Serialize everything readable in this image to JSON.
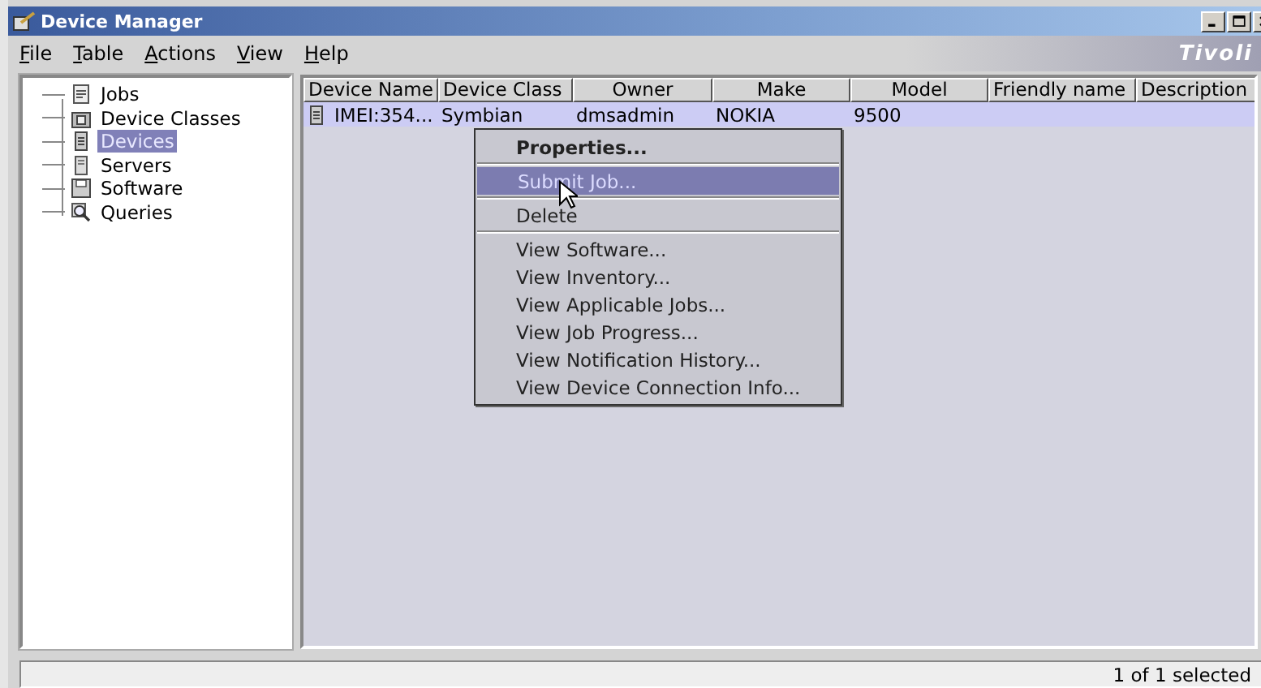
{
  "window": {
    "title": "Device Manager"
  },
  "menubar": [
    {
      "label": "File"
    },
    {
      "label": "Table"
    },
    {
      "label": "Actions"
    },
    {
      "label": "View"
    },
    {
      "label": "Help"
    }
  ],
  "brand": "Tivoli",
  "tree": [
    {
      "label": "Jobs",
      "selected": false
    },
    {
      "label": "Device Classes",
      "selected": false
    },
    {
      "label": "Devices",
      "selected": true
    },
    {
      "label": "Servers",
      "selected": false
    },
    {
      "label": "Software",
      "selected": false
    },
    {
      "label": "Queries",
      "selected": false
    }
  ],
  "table": {
    "columns": [
      "Device Name",
      "Device Class",
      "Owner",
      "Make",
      "Model",
      "Friendly name",
      "Description"
    ],
    "rows": [
      {
        "selected": true,
        "cells": [
          "IMEI:354...",
          "Symbian",
          "dmsadmin",
          "NOKIA",
          "9500",
          "",
          ""
        ]
      }
    ]
  },
  "context_menu": [
    {
      "kind": "item",
      "label": "Properties...",
      "default": true,
      "selected": false
    },
    {
      "kind": "separator"
    },
    {
      "kind": "item",
      "label": "Submit Job...",
      "default": false,
      "selected": true
    },
    {
      "kind": "separator"
    },
    {
      "kind": "item",
      "label": "Delete",
      "default": false,
      "selected": false
    },
    {
      "kind": "separator"
    },
    {
      "kind": "item",
      "label": "View Software...",
      "default": false,
      "selected": false
    },
    {
      "kind": "item",
      "label": "View Inventory...",
      "default": false,
      "selected": false
    },
    {
      "kind": "item",
      "label": "View Applicable Jobs...",
      "default": false,
      "selected": false
    },
    {
      "kind": "item",
      "label": "View Job Progress...",
      "default": false,
      "selected": false
    },
    {
      "kind": "item",
      "label": "View Notification History...",
      "default": false,
      "selected": false
    },
    {
      "kind": "item",
      "label": "View Device Connection Info...",
      "default": false,
      "selected": false
    }
  ],
  "status_bar": "1 of 1 selected"
}
